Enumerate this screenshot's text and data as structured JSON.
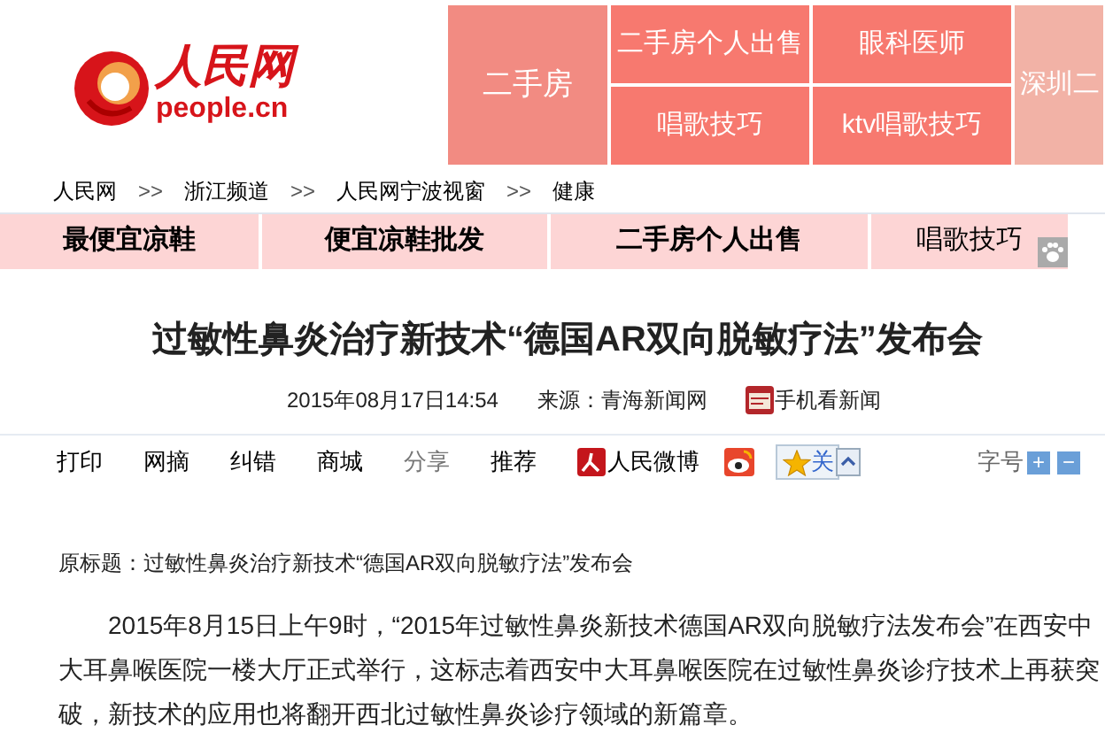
{
  "logo": {
    "name": "人民网",
    "domain": "people.cn"
  },
  "ads": {
    "main": "二手房",
    "cells": [
      "二手房个人出售",
      "眼科医师",
      "唱歌技巧",
      "ktv唱歌技巧"
    ],
    "side": "深圳二"
  },
  "breadcrumb": [
    {
      "label": "人民网"
    },
    {
      "label": "浙江频道"
    },
    {
      "label": "人民网宁波视窗"
    },
    {
      "label": "健康"
    }
  ],
  "breadcrumb_separator": ">>",
  "nav": [
    {
      "label": "最便宜凉鞋",
      "bold": true
    },
    {
      "label": "便宜凉鞋批发",
      "bold": true
    },
    {
      "label": "二手房个人出售",
      "bold": true
    },
    {
      "label": "唱歌技巧",
      "bold": false
    }
  ],
  "title": "过敏性鼻炎治疗新技术“德国AR双向脱敏疗法”发布会",
  "meta": {
    "date": "2015年08月17日14:54",
    "source": "来源：青海新闻网",
    "mobile": "手机看新闻"
  },
  "toolbar": [
    {
      "label": "打印",
      "kind": "link"
    },
    {
      "label": "网摘",
      "kind": "link"
    },
    {
      "label": "纠错",
      "kind": "link"
    },
    {
      "label": "商城",
      "kind": "link"
    },
    {
      "label": "分享",
      "kind": "label"
    },
    {
      "label": "推荐",
      "kind": "link"
    },
    {
      "label": "人民微博",
      "kind": "weibo"
    },
    {
      "kind": "sina"
    },
    {
      "label": "关",
      "kind": "follow"
    }
  ],
  "font_size": {
    "label": "字号",
    "increase": "+",
    "decrease": "−"
  },
  "original_title": "原标题：过敏性鼻炎治疗新技术“德国AR双向脱敏疗法”发布会",
  "paragraph": "2015年8月15日上午9时，“2015年过敏性鼻炎新技术德国AR双向脱敏疗法发布会”在西安中大耳鼻喉医院一楼大厅正式举行，这标志着西安中大耳鼻喉医院在过敏性鼻炎诊疗技术上再获突破，新技术的应用也将翻开西北过敏性鼻炎诊疗领域的新篇章。"
}
